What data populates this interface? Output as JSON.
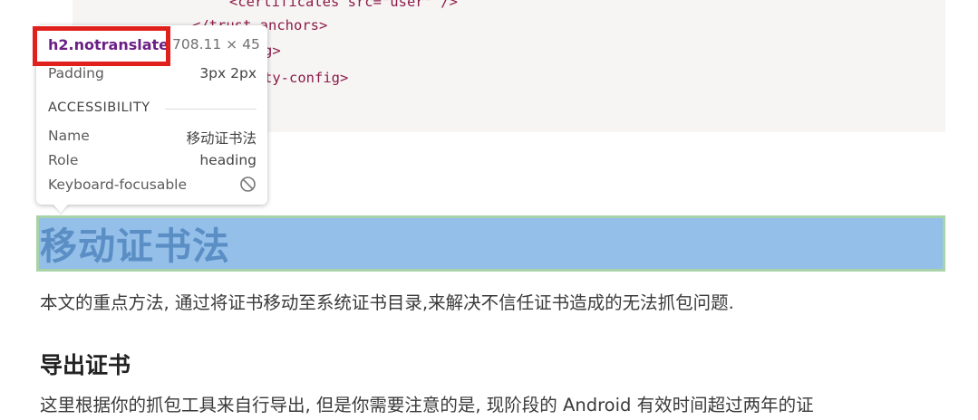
{
  "code": {
    "lines": [
      "<certificates src=\"user\" />",
      "</trust-anchors>",
      "g>",
      "ty-config>"
    ]
  },
  "article": {
    "h2": "移动证书法",
    "intro": "本文的重点方法, 通过将证书移动至系统证书目录,来解决不信任证书造成的无法抓包问题.",
    "h3": "导出证书",
    "para2": "这里根据你的抓包工具来自行导出, 但是你需要注意的是, 现阶段的 Android 有效时间超过两年的证"
  },
  "inspector": {
    "selector": "h2.notranslate",
    "dimensions": "708.11 × 45",
    "padding_label": "Padding",
    "padding_value": "3px 2px",
    "section_title": "ACCESSIBILITY",
    "name_label": "Name",
    "name_value": "移动证书法",
    "role_label": "Role",
    "role_value": "heading",
    "focusable_label": "Keyboard-focusable",
    "focusable_icon": "not-allowed-icon"
  },
  "colors": {
    "highlight_fill": "#93bfe9",
    "highlight_border": "#a8d2a8",
    "annotation_red": "#e0201c",
    "selector_purple": "#6b1f86"
  }
}
